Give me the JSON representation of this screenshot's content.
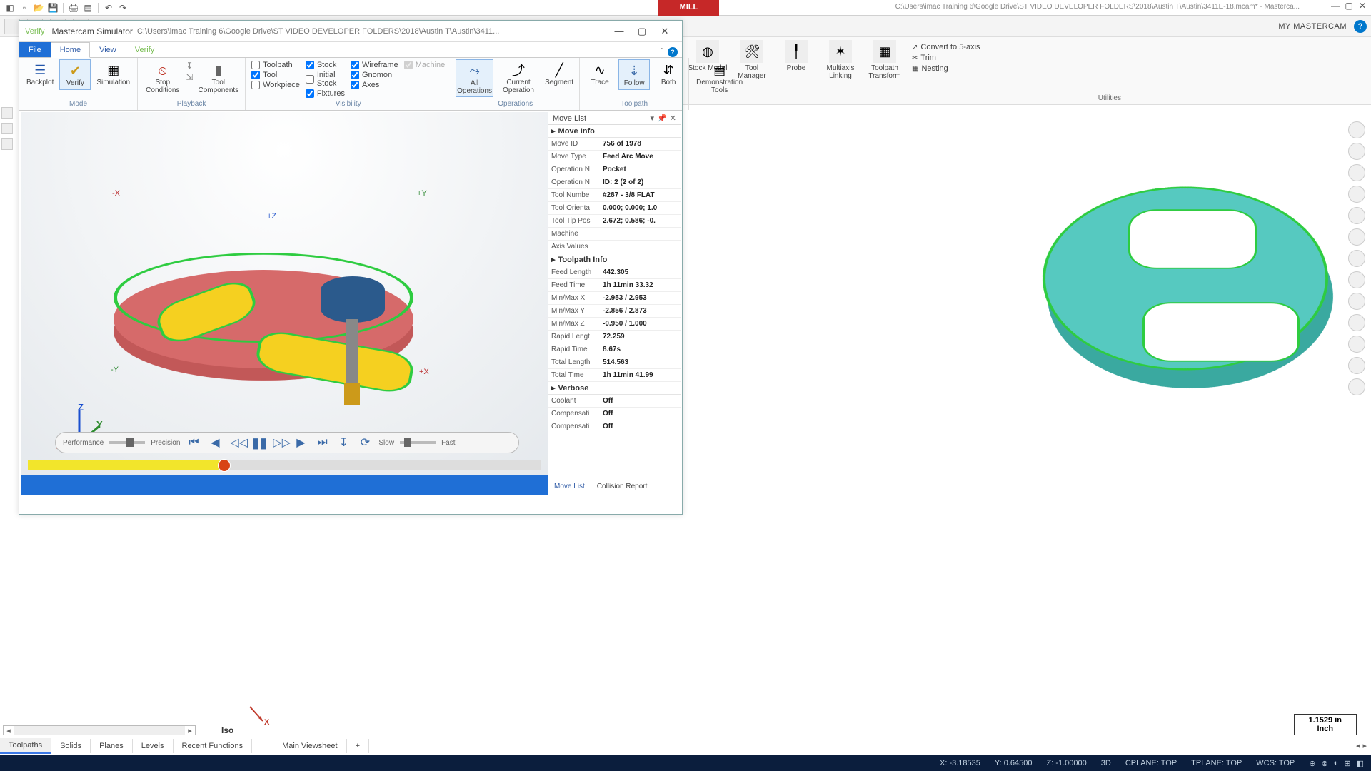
{
  "app": {
    "mill_tab": "MILL",
    "title_path": "C:\\Users\\imac Training 6\\Google Drive\\ST VIDEO DEVELOPER FOLDERS\\2018\\Austin T\\Austin\\3411E-18.mcam* - Masterca...",
    "brand": "MY MASTERCAM"
  },
  "bg_tools": {
    "stock_model": "Stock Model",
    "tool_manager": "Tool Manager",
    "probe": "Probe",
    "multiaxis": "Multiaxis Linking",
    "transform": "Toolpath Transform",
    "convert5": "Convert to 5-axis",
    "trim": "Trim",
    "nesting": "Nesting",
    "group": "Utilities"
  },
  "sim": {
    "verify_small": "Verify",
    "title": "Mastercam Simulator",
    "path": "C:\\Users\\imac Training 6\\Google Drive\\ST VIDEO DEVELOPER FOLDERS\\2018\\Austin T\\Austin\\3411...",
    "tabs": {
      "file": "File",
      "home": "Home",
      "view": "View",
      "verify": "Verify"
    }
  },
  "ribbon": {
    "mode": {
      "backplot": "Backplot",
      "verify": "Verify",
      "simulation": "Simulation",
      "label": "Mode"
    },
    "playback": {
      "stop": "Stop Conditions",
      "toolcomp": "Tool Components",
      "label": "Playback"
    },
    "visibility": {
      "toolpath": "Toolpath",
      "tool": "Tool",
      "workpiece": "Workpiece",
      "stock": "Stock",
      "initial": "Initial Stock",
      "fixtures": "Fixtures",
      "wireframe": "Wireframe",
      "gnomon": "Gnomon",
      "axes": "Axes",
      "machine": "Machine",
      "label": "Visibility"
    },
    "operations": {
      "all": "All Operations",
      "current": "Current Operation",
      "segment": "Segment",
      "label": "Operations"
    },
    "toolpath": {
      "trace": "Trace",
      "follow": "Follow",
      "both": "Both",
      "demo": "Demonstration Tools",
      "label": "Toolpath"
    }
  },
  "axis": {
    "mx": "-X",
    "px": "+X",
    "my": "-Y",
    "py": "+Y",
    "pz": "+Z",
    "z": "Z",
    "y": "Y",
    "x": "X"
  },
  "playback": {
    "perf": "Performance",
    "prec": "Precision",
    "slow": "Slow",
    "fast": "Fast"
  },
  "panel": {
    "title": "Move List",
    "move_info": "Move Info",
    "toolpath_info": "Toolpath Info",
    "verbose": "Verbose",
    "rows": {
      "move_id": {
        "k": "Move ID",
        "v": "756 of 1978"
      },
      "move_type": {
        "k": "Move Type",
        "v": "Feed Arc Move"
      },
      "op_name": {
        "k": "Operation N",
        "v": "Pocket"
      },
      "op_num": {
        "k": "Operation N",
        "v": "ID: 2 (2 of 2)"
      },
      "tool_num": {
        "k": "Tool Numbe",
        "v": "#287 - 3/8 FLAT"
      },
      "tool_orient": {
        "k": "Tool Orienta",
        "v": "0.000; 0.000; 1.0"
      },
      "tool_tip": {
        "k": "Tool Tip Pos",
        "v": "2.672; 0.586; -0."
      },
      "machine": {
        "k": "Machine",
        "v": ""
      },
      "axis_vals": {
        "k": "Axis Values",
        "v": ""
      },
      "feed_len": {
        "k": "Feed Length",
        "v": "442.305"
      },
      "feed_time": {
        "k": "Feed Time",
        "v": "1h 11min 33.32"
      },
      "minmax_x": {
        "k": "Min/Max X",
        "v": "-2.953 / 2.953"
      },
      "minmax_y": {
        "k": "Min/Max Y",
        "v": "-2.856 / 2.873"
      },
      "minmax_z": {
        "k": "Min/Max Z",
        "v": "-0.950 / 1.000"
      },
      "rapid_len": {
        "k": "Rapid Lengt",
        "v": "72.259"
      },
      "rapid_time": {
        "k": "Rapid Time",
        "v": "8.67s"
      },
      "total_len": {
        "k": "Total Length",
        "v": "514.563"
      },
      "total_time": {
        "k": "Total Time",
        "v": "1h 11min 41.99"
      },
      "coolant": {
        "k": "Coolant",
        "v": "Off"
      },
      "comp1": {
        "k": "Compensati",
        "v": "Off"
      },
      "comp2": {
        "k": "Compensati",
        "v": "Off"
      }
    },
    "tabs": {
      "movelist": "Move List",
      "collision": "Collision Report"
    }
  },
  "bottom_tabs": {
    "toolpaths": "Toolpaths",
    "solids": "Solids",
    "planes": "Planes",
    "levels": "Levels",
    "recent": "Recent Functions",
    "main": "Main Viewsheet"
  },
  "iso": "Iso",
  "scale": {
    "v": "1.1529 in",
    "u": "Inch"
  },
  "status": {
    "x": "X:   -3.18535",
    "y": "Y:   0.64500",
    "z": "Z:   -1.00000",
    "d": "3D",
    "cplane": "CPLANE: TOP",
    "tplane": "TPLANE: TOP",
    "wcs": "WCS: TOP"
  }
}
